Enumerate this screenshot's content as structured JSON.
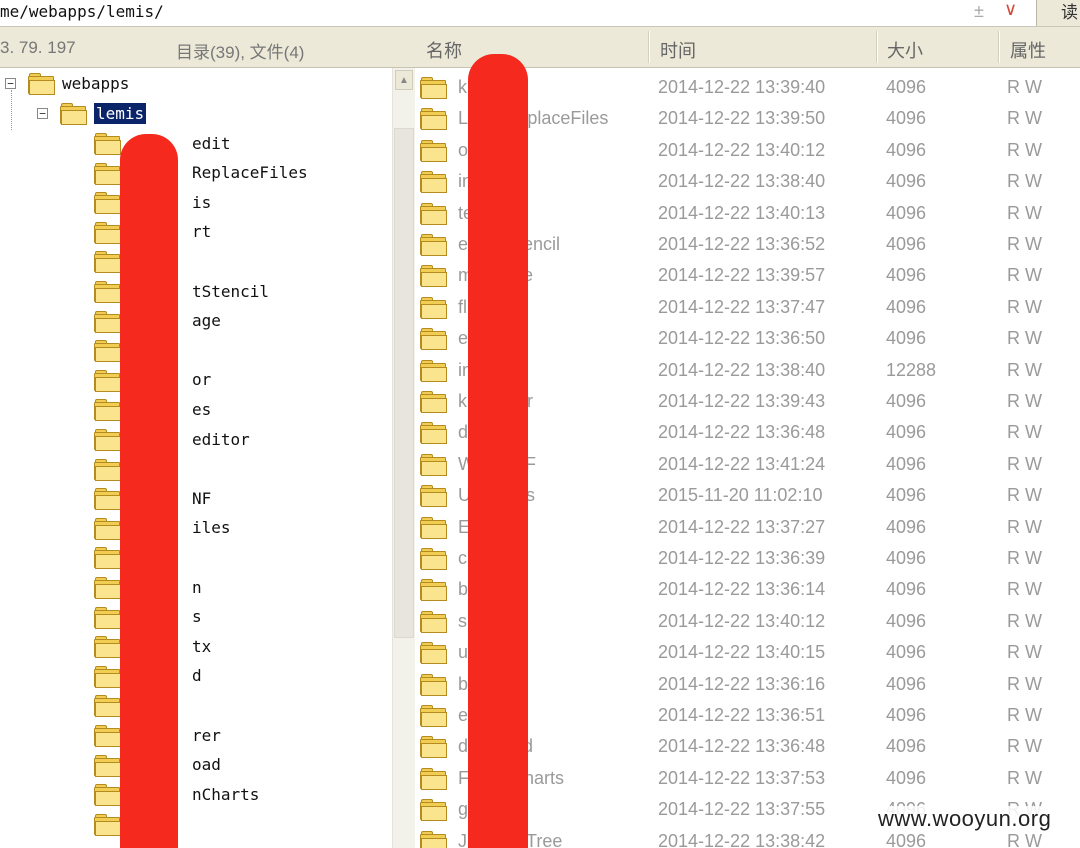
{
  "address": {
    "path": "me/webapps/lemis/",
    "add_glyph": "±",
    "dropdown_glyph": "∨",
    "read_button": "读"
  },
  "header": {
    "ip": "3. 79. 197",
    "counts": "目录(39), 文件(4)",
    "columns": {
      "name": "名称",
      "time": "时间",
      "size": "大小",
      "attr": "属性"
    }
  },
  "tree": {
    "root": {
      "label": "webapps",
      "expander": "−"
    },
    "current": {
      "label": "lemis",
      "expander": "−"
    },
    "children": [
      "edit",
      "ReplaceFiles",
      "is",
      "rt",
      "",
      "tStencil",
      "age",
      "",
      "or",
      "es",
      "editor",
      "",
      "NF",
      "iles",
      "",
      "n",
      "s",
      "tx",
      "d",
      "",
      "rer",
      "oad",
      "nCharts",
      ""
    ]
  },
  "files": [
    {
      "name": "k",
      "time": "2014-12-22 13:39:40",
      "size": "4096",
      "attr": "R W"
    },
    {
      "name": "L            placeFiles",
      "time": "2014-12-22 13:39:50",
      "size": "4096",
      "attr": "R W"
    },
    {
      "name": "o",
      "time": "2014-12-22 13:40:12",
      "size": "4096",
      "attr": "R W"
    },
    {
      "name": "in",
      "time": "2014-12-22 13:38:40",
      "size": "4096",
      "attr": "R W"
    },
    {
      "name": "te",
      "time": "2014-12-22 13:40:13",
      "size": "4096",
      "attr": "R W"
    },
    {
      "name": "e           encil",
      "time": "2014-12-22 13:36:52",
      "size": "4096",
      "attr": "R W"
    },
    {
      "name": "m          e",
      "time": "2014-12-22 13:39:57",
      "size": "4096",
      "attr": "R W"
    },
    {
      "name": "fl",
      "time": "2014-12-22 13:37:47",
      "size": "4096",
      "attr": "R W"
    },
    {
      "name": "e",
      "time": "2014-12-22 13:36:50",
      "size": "4096",
      "attr": "R W"
    },
    {
      "name": "in",
      "time": "2014-12-22 13:38:40",
      "size": "12288",
      "attr": "R W"
    },
    {
      "name": "k          or",
      "time": "2014-12-22 13:39:43",
      "size": "4096",
      "attr": "R W"
    },
    {
      "name": "d",
      "time": "2014-12-22 13:36:48",
      "size": "4096",
      "attr": "R W"
    },
    {
      "name": "W          F",
      "time": "2014-12-22 13:41:24",
      "size": "4096",
      "attr": "R W"
    },
    {
      "name": "U           s",
      "time": "2015-11-20 11:02:10",
      "size": "4096",
      "attr": "R W"
    },
    {
      "name": "E",
      "time": "2014-12-22 13:37:27",
      "size": "4096",
      "attr": "R W"
    },
    {
      "name": "c",
      "time": "2014-12-22 13:36:39",
      "size": "4096",
      "attr": "R W"
    },
    {
      "name": "b",
      "time": "2014-12-22 13:36:14",
      "size": "4096",
      "attr": "R W"
    },
    {
      "name": "s",
      "time": "2014-12-22 13:40:12",
      "size": "4096",
      "attr": "R W"
    },
    {
      "name": "u",
      "time": "2014-12-22 13:40:15",
      "size": "4096",
      "attr": "R W"
    },
    {
      "name": "b",
      "time": "2014-12-22 13:36:16",
      "size": "4096",
      "attr": "R W"
    },
    {
      "name": "e",
      "time": "2014-12-22 13:36:51",
      "size": "4096",
      "attr": "R W"
    },
    {
      "name": "d           d",
      "time": "2014-12-22 13:36:48",
      "size": "4096",
      "attr": "R W"
    },
    {
      "name": "F           harts",
      "time": "2014-12-22 13:37:53",
      "size": "4096",
      "attr": "R W"
    },
    {
      "name": "g",
      "time": "2014-12-22 13:37:55",
      "size": "4096",
      "attr": "R W"
    },
    {
      "name": "JL          Tree",
      "time": "2014-12-22 13:38:42",
      "size": "4096",
      "attr": "R W"
    }
  ],
  "watermark": "www.wooyun.org",
  "colors": {
    "redaction": "#f5291e",
    "selection": "#0a246a",
    "folder": "#f1cd54"
  }
}
